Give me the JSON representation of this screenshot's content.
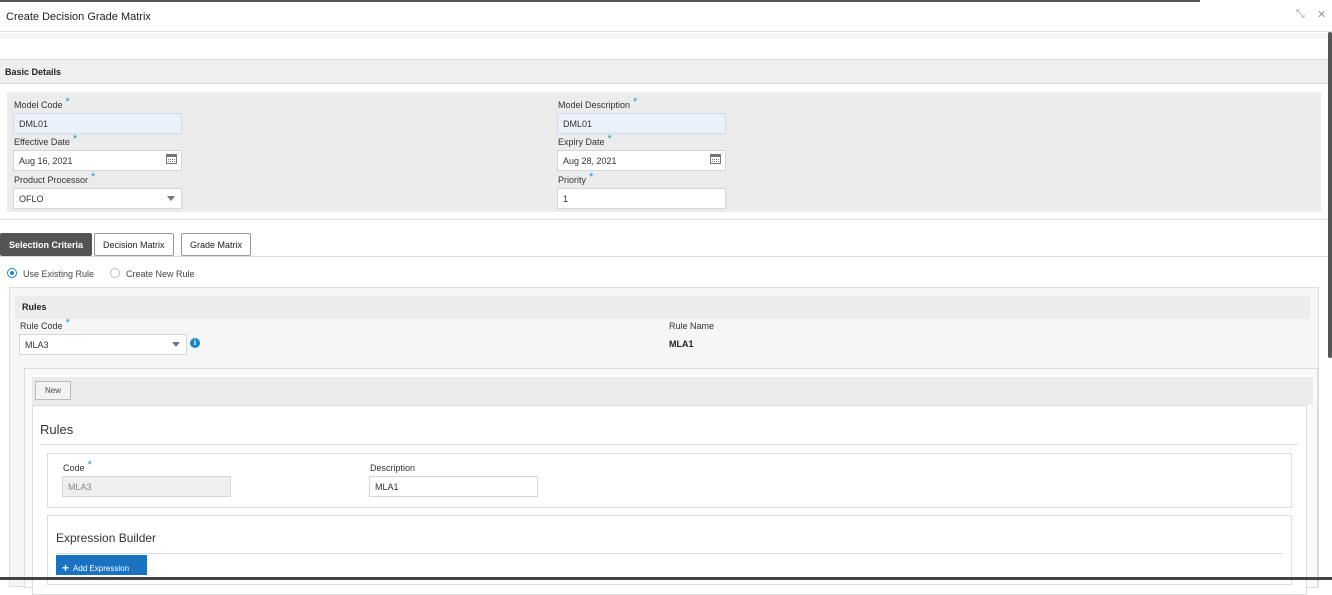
{
  "window": {
    "title": "Create Decision Grade Matrix",
    "minimize_glyph": "⤡",
    "close_glyph": "✕"
  },
  "basic_details": {
    "header": "Basic Details",
    "model_code": {
      "label": "Model Code",
      "value": "DML01"
    },
    "model_description": {
      "label": "Model Description",
      "value": "DML01"
    },
    "effective_date": {
      "label": "Effective Date",
      "value": "Aug 16, 2021"
    },
    "expiry_date": {
      "label": "Expiry Date",
      "value": "Aug 28, 2021"
    },
    "product_processor": {
      "label": "Product Processor",
      "value": "OFLO"
    },
    "priority": {
      "label": "Priority",
      "value": "1"
    },
    "required_mark": "*"
  },
  "tabs": [
    {
      "label": "Selection Criteria",
      "active": true
    },
    {
      "label": "Decision Matrix",
      "active": false
    },
    {
      "label": "Grade Matrix",
      "active": false
    }
  ],
  "rule_mode": {
    "options": [
      "Use Existing Rule",
      "Create New Rule"
    ],
    "selected": "Use Existing Rule"
  },
  "rules": {
    "header": "Rules",
    "rule_code": {
      "label": "Rule Code",
      "value": "MLA3"
    },
    "rule_name": {
      "label": "Rule Name",
      "value": "MLA1"
    },
    "info_glyph": "i",
    "new_button": "New",
    "card_title": "Rules",
    "code": {
      "label": "Code",
      "value": "MLA3"
    },
    "description": {
      "label": "Description",
      "value": "MLA1"
    },
    "expression_builder": {
      "title": "Expression Builder",
      "add_button": "Add Expression",
      "add_glyph": "+"
    }
  },
  "colors": {
    "accent": "#1a86c9",
    "primary_button": "#1a73c2",
    "active_tab": "#545454"
  }
}
